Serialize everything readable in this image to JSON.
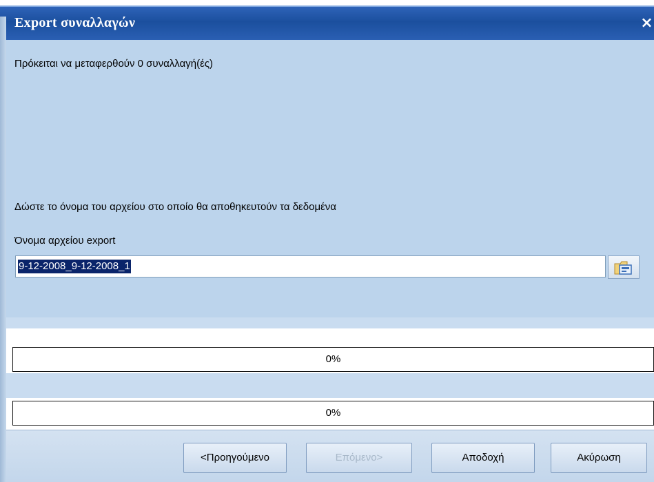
{
  "window": {
    "title": "Export συναλλαγών",
    "close_glyph": "×"
  },
  "messages": {
    "transfer_count": "Πρόκειται να μεταφερθούν 0 συναλλαγή(ές)",
    "filename_prompt": "Δώστε το όνομα του αρχείου στο οποίο θα αποθηκευτούν τα δεδομένα",
    "filename_label": "Όνομα αρχείου export"
  },
  "export_file": {
    "value": "9-12-2008_9-12-2008_1",
    "browse_icon": "folder-browse-icon"
  },
  "progress": [
    {
      "value": 0,
      "label": "0%"
    },
    {
      "value": 0,
      "label": "0%"
    }
  ],
  "buttons": {
    "previous": "<Προηγούμενο",
    "next": "Επόμενο>",
    "accept": "Αποδοχή",
    "cancel": "Ακύρωση"
  },
  "colors": {
    "titlebar": "#1b4f9e",
    "panel": "#bcd4ec",
    "progress_fill": "#2f63b4"
  }
}
